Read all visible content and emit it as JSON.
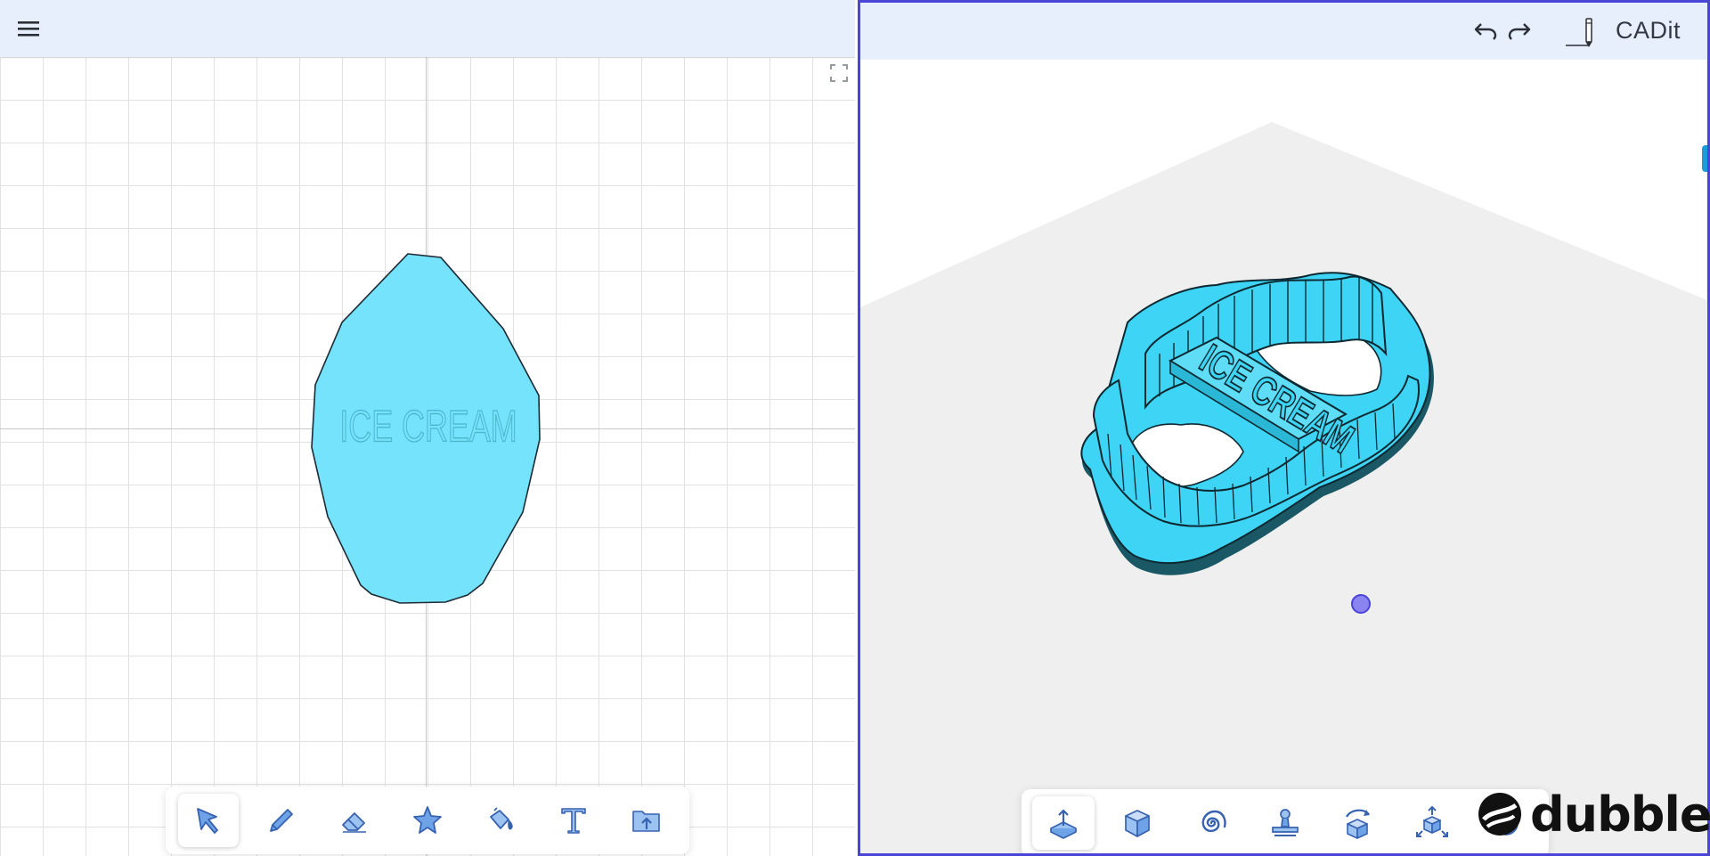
{
  "app": {
    "brand_title": "CADit",
    "accent_color": "#4a44d8",
    "shape_fill": "#75e3fb",
    "header_color": "#e7effd"
  },
  "header_left": {
    "menu_icon": "hamburger-menu-icon"
  },
  "header_right": {
    "undo_icon": "undo-icon",
    "redo_icon": "redo-icon",
    "brand_icon": "pencil-ruler-icon"
  },
  "canvas_2d": {
    "shape_text": "ICE CREAM",
    "shape_color": "#75e3fb"
  },
  "scene_3d": {
    "embossed_text": "ICE CREAM",
    "model_color": "#3dd4f5"
  },
  "toolbar_2d": {
    "tools": [
      {
        "name": "select",
        "icon": "select-arrow-icon",
        "active": true
      },
      {
        "name": "pencil",
        "icon": "pencil-icon",
        "active": false
      },
      {
        "name": "eraser",
        "icon": "eraser-icon",
        "active": false
      },
      {
        "name": "star",
        "icon": "star-shape-icon",
        "active": false
      },
      {
        "name": "fill",
        "icon": "paint-bucket-icon",
        "active": false
      },
      {
        "name": "text",
        "icon": "text-icon",
        "active": false
      },
      {
        "name": "import",
        "icon": "folder-upload-icon",
        "active": false
      }
    ]
  },
  "toolbar_3d": {
    "tools": [
      {
        "name": "extrude",
        "icon": "extrude-icon",
        "active": true
      },
      {
        "name": "box",
        "icon": "box-icon",
        "active": false
      },
      {
        "name": "spiral",
        "icon": "spiral-icon",
        "active": false
      },
      {
        "name": "stamp",
        "icon": "stamp-icon",
        "active": false
      },
      {
        "name": "rotate",
        "icon": "rotate-cube-icon",
        "active": false
      },
      {
        "name": "scale",
        "icon": "scale-cube-icon",
        "active": false
      },
      {
        "name": "globe",
        "icon": "globe-icon",
        "active": false
      }
    ]
  },
  "watermark": {
    "text": "dubble"
  }
}
